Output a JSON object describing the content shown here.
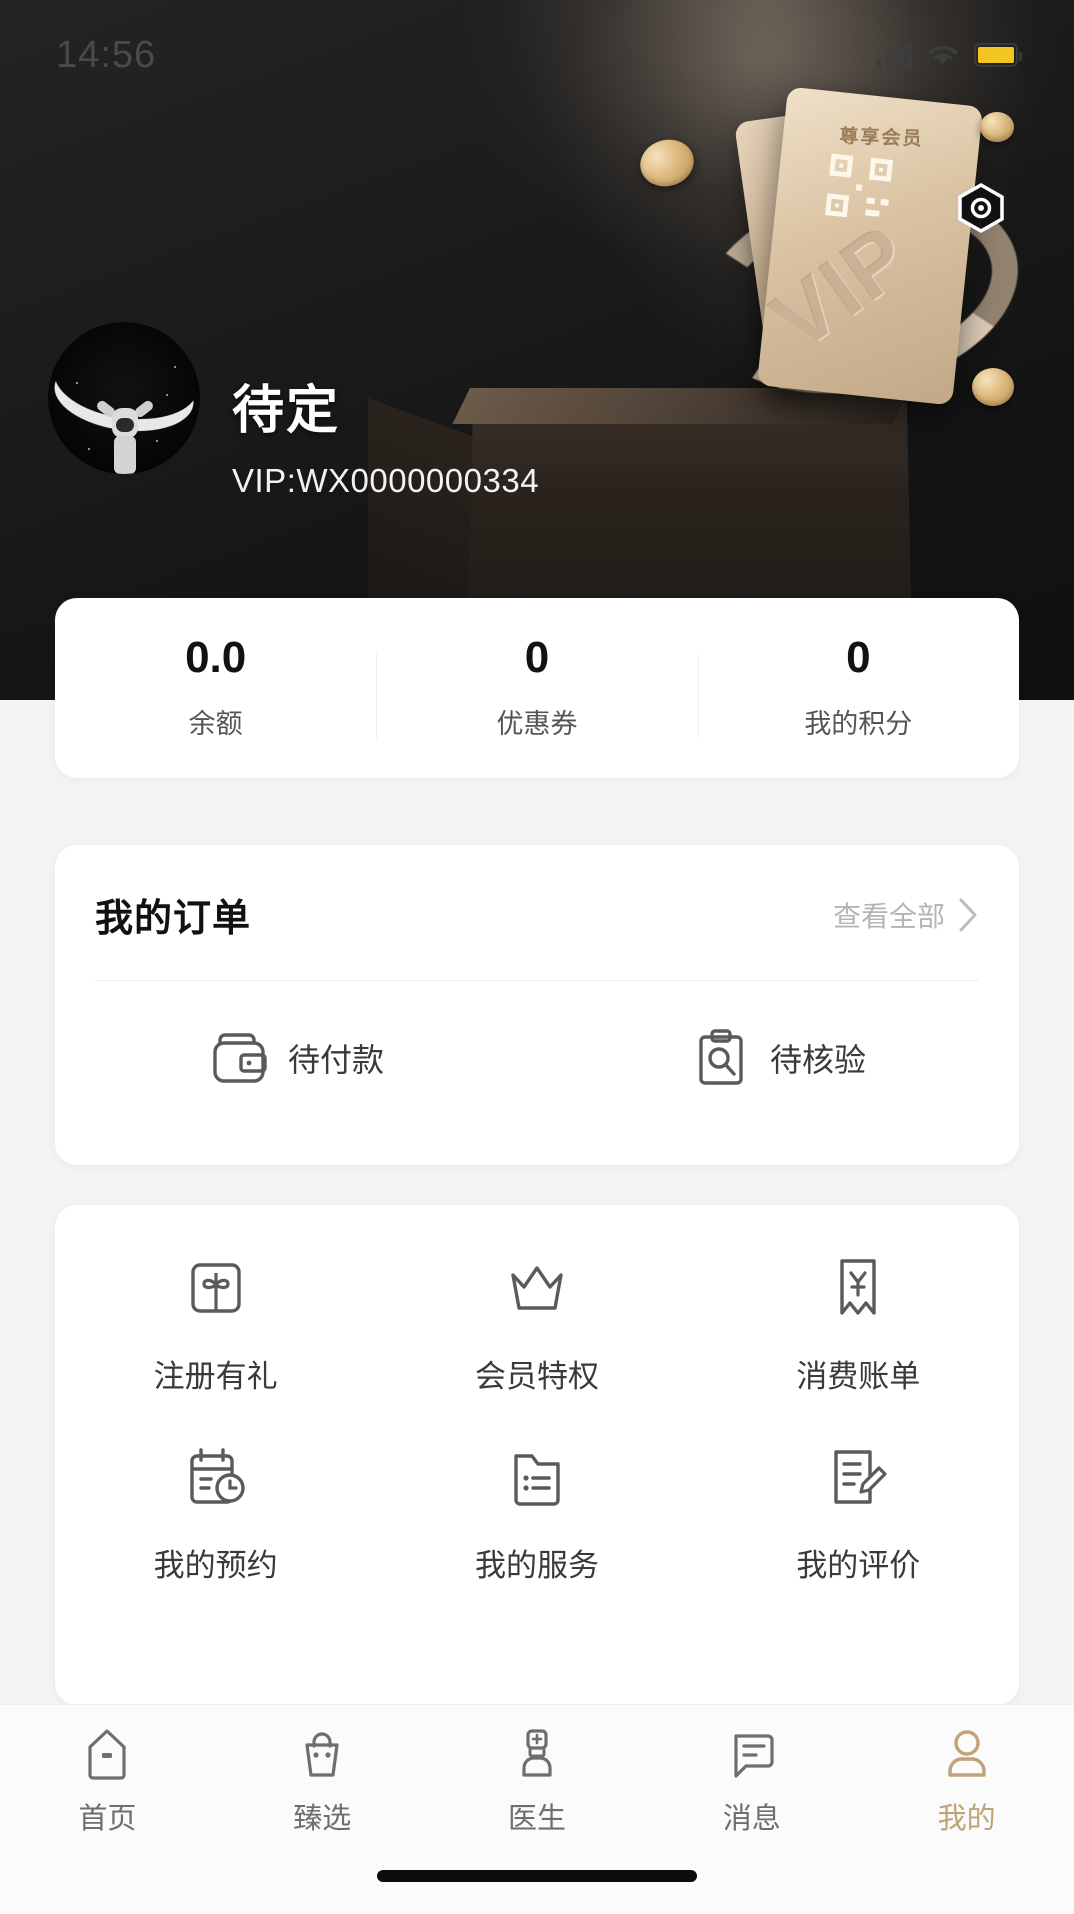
{
  "status_bar": {
    "time": "14:56",
    "signal_icon": "cellular-signal-icon",
    "wifi_icon": "wifi-icon",
    "battery_icon": "battery-icon",
    "battery_color": "#f3c521"
  },
  "hero": {
    "badge_icon": "hexagon-scan-icon",
    "card_title": "尊享会员",
    "card_emboss": "VIP",
    "qr_icon": "qr-code-icon",
    "background_color": "#1a1a1a"
  },
  "profile": {
    "avatar_icon": "astronaut-avatar",
    "name": "待定",
    "vip_id": "VIP:WX0000000334"
  },
  "stats": [
    {
      "value": "0.0",
      "label": "余额"
    },
    {
      "value": "0",
      "label": "优惠券"
    },
    {
      "value": "0",
      "label": "我的积分"
    }
  ],
  "orders": {
    "title": "我的订单",
    "more_label": "查看全部",
    "more_icon": "chevron-right-icon",
    "items": [
      {
        "label": "待付款",
        "icon": "wallet-icon"
      },
      {
        "label": "待核验",
        "icon": "clipboard-search-icon"
      }
    ]
  },
  "services": [
    {
      "label": "注册有礼",
      "icon": "gift-icon"
    },
    {
      "label": "会员特权",
      "icon": "crown-icon"
    },
    {
      "label": "消费账单",
      "icon": "bookmark-yuan-icon"
    },
    {
      "label": "我的预约",
      "icon": "calendar-clock-icon"
    },
    {
      "label": "我的服务",
      "icon": "document-list-icon"
    },
    {
      "label": "我的评价",
      "icon": "document-edit-icon"
    }
  ],
  "tabbar": {
    "active_color": "#c0a376",
    "inactive_color": "#6e6e6e",
    "items": [
      {
        "label": "首页",
        "icon": "home-icon",
        "active": false
      },
      {
        "label": "臻选",
        "icon": "shopping-bag-icon",
        "active": false
      },
      {
        "label": "医生",
        "icon": "doctor-icon",
        "active": false
      },
      {
        "label": "消息",
        "icon": "message-icon",
        "active": false
      },
      {
        "label": "我的",
        "icon": "user-icon",
        "active": true
      }
    ]
  }
}
